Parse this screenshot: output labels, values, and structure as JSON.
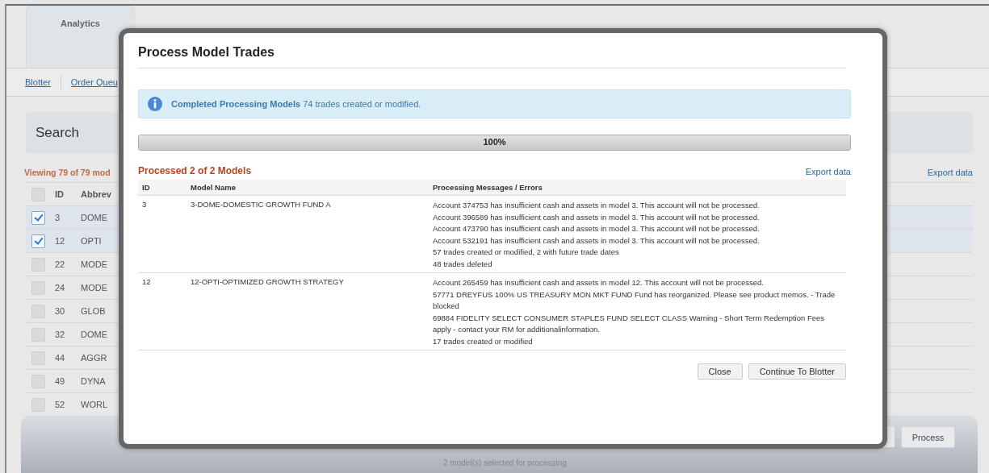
{
  "tabs": [
    {
      "label": "Analytics",
      "selected": false
    }
  ],
  "subnav": [
    {
      "label": "Blotter"
    },
    {
      "label": "Order Queu"
    }
  ],
  "search": {
    "title": "Search"
  },
  "viewing": "Viewing 79 of 79 mod",
  "export_label": "Export data",
  "models_table": {
    "columns": [
      "ID",
      "Abbrev"
    ],
    "header_checked": false,
    "rows": [
      {
        "id": "3",
        "abbrev": "DOME",
        "checked": true
      },
      {
        "id": "12",
        "abbrev": "OPTI",
        "checked": true
      },
      {
        "id": "22",
        "abbrev": "MODE",
        "checked": false
      },
      {
        "id": "24",
        "abbrev": "MODE",
        "checked": false
      },
      {
        "id": "30",
        "abbrev": "GLOB",
        "checked": false
      },
      {
        "id": "32",
        "abbrev": "DOME",
        "checked": false
      },
      {
        "id": "44",
        "abbrev": "AGGR",
        "checked": false
      },
      {
        "id": "49",
        "abbrev": "DYNA",
        "checked": false
      },
      {
        "id": "52",
        "abbrev": "WORL",
        "checked": false
      }
    ]
  },
  "footer": {
    "process_button": "Process",
    "status": "2 model(s) selected for processing"
  },
  "dialog": {
    "title": "Process Model Trades",
    "alert": "**Completed Processing Models** 74 trades created or modified.",
    "progress": {
      "level": 1,
      "label": "100%"
    },
    "summary": "Processed 2 of 2 Models",
    "export_label": "Export data",
    "columns": [
      "ID",
      "Model Name",
      "Processing Messages / Errors"
    ],
    "rows": [
      {
        "id": "3",
        "model": "3-DOME-DOMESTIC GROWTH FUND A",
        "messages": [
          "Account 374753 has insufficient cash and assets in model 3. This account will not be processed.",
          "Account 396589 has insufficient cash and assets in model 3. This account will not be processed.",
          "Account 473790 has insufficient cash and assets in model 3. This account will not be processed.",
          "Account 532191 has insufficient cash and assets in model 3. This account will not be processed.",
          "57 trades created or modified, 2 with future trade dates",
          "48 trades deleted"
        ]
      },
      {
        "id": "12",
        "model": "12-OPTI-OPTIMIZED GROWTH STRATEGY",
        "messages": [
          "Account 265459 has insufficient cash and assets in model 12. This account will not be processed.",
          "57771 DREYFUS 100% US TREASURY MON MKT FUND Fund has reorganized. Please see product memos. - Trade blocked",
          "69884 FIDELITY SELECT CONSUMER STAPLES FUND SELECT CLASS Warning - Short Term Redemption Fees apply - contact your RM for additionalinformation.",
          "17 trades created or modified"
        ]
      }
    ],
    "buttons": [
      "Close",
      "Continue To Blotter"
    ]
  }
}
